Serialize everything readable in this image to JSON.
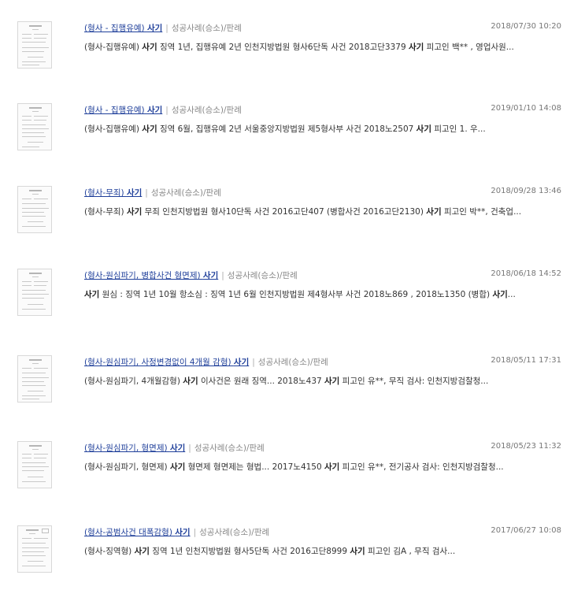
{
  "results": [
    {
      "title_pre": "(형사 - 집행유예) ",
      "title_kw": "사기",
      "separator": "|",
      "category": "성공사례(승소)/판례",
      "date": "2018/07/30 10:20",
      "snippet_parts": [
        {
          "text": "(형사-집행유예) ",
          "bold": false
        },
        {
          "text": "사기",
          "bold": true
        },
        {
          "text": " 징역 1년, 집행유예 2년 인천지방법원 형사6단독 사건 2018고단3379 ",
          "bold": false
        },
        {
          "text": "사기",
          "bold": true
        },
        {
          "text": " 피고인 백** , 영업사원...",
          "bold": false
        }
      ]
    },
    {
      "title_pre": "(형사 - 집행유예) ",
      "title_kw": "사기",
      "separator": "|",
      "category": "성공사례(승소)/판례",
      "date": "2019/01/10 14:08",
      "snippet_parts": [
        {
          "text": "(형사-집행유예) ",
          "bold": false
        },
        {
          "text": "사기",
          "bold": true
        },
        {
          "text": " 징역 6월, 집행유예 2년 서울중앙지방법원 제5형사부 사건 2018노2507 ",
          "bold": false
        },
        {
          "text": "사기",
          "bold": true
        },
        {
          "text": " 피고인 1. 우...",
          "bold": false
        }
      ]
    },
    {
      "title_pre": "(형사-무죄) ",
      "title_kw": "사기",
      "separator": "|",
      "category": "성공사례(승소)/판례",
      "date": "2018/09/28 13:46",
      "snippet_parts": [
        {
          "text": "(형사-무죄) ",
          "bold": false
        },
        {
          "text": "사기",
          "bold": true
        },
        {
          "text": " 무죄 인천지방법원 형사10단독 사건 2016고단407 (병합사건 2016고단2130) ",
          "bold": false
        },
        {
          "text": "사기",
          "bold": true
        },
        {
          "text": " 피고인 박**, 건축업...",
          "bold": false
        }
      ]
    },
    {
      "title_pre": "(형사-원심파기, 병합사건 형면제) ",
      "title_kw": "사기",
      "separator": "|",
      "category": "성공사례(승소)/판례",
      "date": "2018/06/18 14:52",
      "snippet_parts": [
        {
          "text": "사기",
          "bold": true
        },
        {
          "text": " 원심 : 징역 1년 10월 항소심 : 징역 1년 6월 인천지방법원 제4형사부 사건 2018노869 , 2018노1350 (병합) ",
          "bold": false
        },
        {
          "text": "사기",
          "bold": true
        },
        {
          "text": "...",
          "bold": false
        }
      ]
    },
    {
      "title_pre": "(형사-원심파기, 사정변경없이 4개월 감형) ",
      "title_kw": "사기",
      "separator": "|",
      "category": "성공사례(승소)/판례",
      "date": "2018/05/11 17:31",
      "snippet_parts": [
        {
          "text": "(형사-원심파기, 4개월감형) ",
          "bold": false
        },
        {
          "text": "사기",
          "bold": true
        },
        {
          "text": " 이사건은 원래 징역... 2018노437 ",
          "bold": false
        },
        {
          "text": "사기",
          "bold": true
        },
        {
          "text": " 피고인 유**, 무직 검사: 인천지방검찰청...",
          "bold": false
        }
      ]
    },
    {
      "title_pre": "(형사-원심파기, 형면제) ",
      "title_kw": "사기",
      "separator": "|",
      "category": "성공사례(승소)/판례",
      "date": "2018/05/23 11:32",
      "snippet_parts": [
        {
          "text": "(형사-원심파기, 형면제) ",
          "bold": false
        },
        {
          "text": "사기",
          "bold": true
        },
        {
          "text": " 형면제 형면제는 형법... 2017노4150 ",
          "bold": false
        },
        {
          "text": "사기",
          "bold": true
        },
        {
          "text": " 피고인 유**, 전기공사 검사: 인천지방검찰청...",
          "bold": false
        }
      ]
    },
    {
      "title_pre": "(형사-공범사건 대폭감형) ",
      "title_kw": "사기",
      "separator": "|",
      "category": "성공사례(승소)/판례",
      "date": "2017/06/27 10:08",
      "snippet_parts": [
        {
          "text": "(형사-징역형) ",
          "bold": false
        },
        {
          "text": "사기",
          "bold": true
        },
        {
          "text": " 징역 1년 인천지방법원 형사5단독 사건 2016고단8999 ",
          "bold": false
        },
        {
          "text": "사기",
          "bold": true
        },
        {
          "text": " 피고인 김A , 무직 검사...",
          "bold": false
        }
      ]
    }
  ]
}
